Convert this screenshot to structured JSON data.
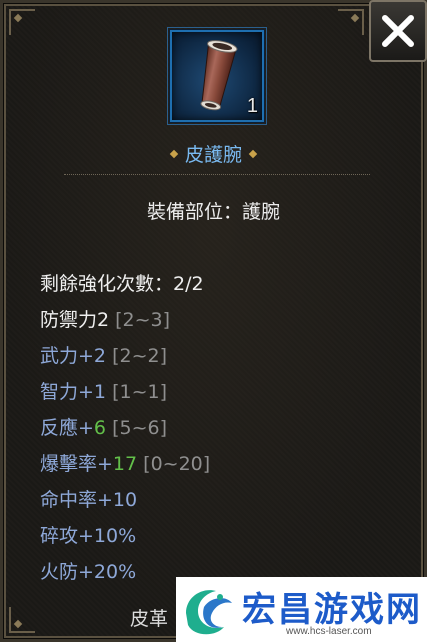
{
  "item": {
    "count": "1",
    "name": "皮護腕",
    "slot_line": "裝備部位：護腕"
  },
  "stats": {
    "enhance": "剩餘強化次數：2/2",
    "defense_label": "防禦力2",
    "defense_range": "[2~3]",
    "force_label": "武力+2",
    "force_range": "[2~2]",
    "int_label": "智力+1",
    "int_range": "[1~1]",
    "reflex_label": "反應+",
    "reflex_bonus": "6",
    "reflex_range": "[5~6]",
    "crit_label": "爆擊率+",
    "crit_bonus": "17",
    "crit_range": "[0~20]",
    "hit": "命中率+10",
    "pierce": "碎攻+10%",
    "fire_res": "火防+20%"
  },
  "footer_text": "皮革",
  "watermark": {
    "title": "宏昌游戏网",
    "url": "www.hcs-laser.com"
  },
  "colors": {
    "item_name": "#79b9f0",
    "stat_blue": "#8ea8d8",
    "stat_green": "#63c04a",
    "watermark": "#1d5bc9"
  },
  "icons": {
    "close": "close-x-icon",
    "item": "leather-bracer-icon"
  }
}
